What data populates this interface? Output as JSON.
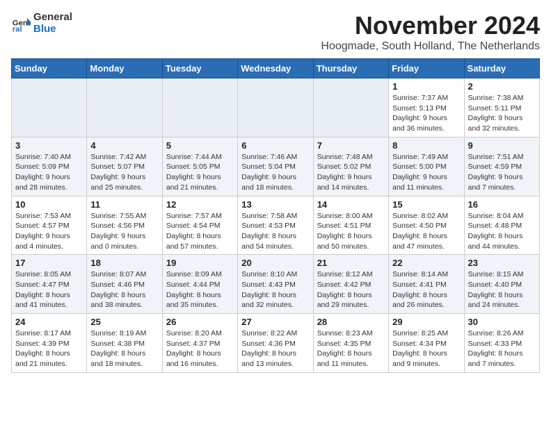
{
  "logo": {
    "text_general": "General",
    "text_blue": "Blue"
  },
  "header": {
    "month": "November 2024",
    "location": "Hoogmade, South Holland, The Netherlands"
  },
  "weekdays": [
    "Sunday",
    "Monday",
    "Tuesday",
    "Wednesday",
    "Thursday",
    "Friday",
    "Saturday"
  ],
  "weeks": [
    [
      {
        "day": "",
        "sunrise": "",
        "sunset": "",
        "daylight": "",
        "empty": true
      },
      {
        "day": "",
        "sunrise": "",
        "sunset": "",
        "daylight": "",
        "empty": true
      },
      {
        "day": "",
        "sunrise": "",
        "sunset": "",
        "daylight": "",
        "empty": true
      },
      {
        "day": "",
        "sunrise": "",
        "sunset": "",
        "daylight": "",
        "empty": true
      },
      {
        "day": "",
        "sunrise": "",
        "sunset": "",
        "daylight": "",
        "empty": true
      },
      {
        "day": "1",
        "sunrise": "Sunrise: 7:37 AM",
        "sunset": "Sunset: 5:13 PM",
        "daylight": "Daylight: 9 hours and 36 minutes.",
        "empty": false
      },
      {
        "day": "2",
        "sunrise": "Sunrise: 7:38 AM",
        "sunset": "Sunset: 5:11 PM",
        "daylight": "Daylight: 9 hours and 32 minutes.",
        "empty": false
      }
    ],
    [
      {
        "day": "3",
        "sunrise": "Sunrise: 7:40 AM",
        "sunset": "Sunset: 5:09 PM",
        "daylight": "Daylight: 9 hours and 28 minutes.",
        "empty": false
      },
      {
        "day": "4",
        "sunrise": "Sunrise: 7:42 AM",
        "sunset": "Sunset: 5:07 PM",
        "daylight": "Daylight: 9 hours and 25 minutes.",
        "empty": false
      },
      {
        "day": "5",
        "sunrise": "Sunrise: 7:44 AM",
        "sunset": "Sunset: 5:05 PM",
        "daylight": "Daylight: 9 hours and 21 minutes.",
        "empty": false
      },
      {
        "day": "6",
        "sunrise": "Sunrise: 7:46 AM",
        "sunset": "Sunset: 5:04 PM",
        "daylight": "Daylight: 9 hours and 18 minutes.",
        "empty": false
      },
      {
        "day": "7",
        "sunrise": "Sunrise: 7:48 AM",
        "sunset": "Sunset: 5:02 PM",
        "daylight": "Daylight: 9 hours and 14 minutes.",
        "empty": false
      },
      {
        "day": "8",
        "sunrise": "Sunrise: 7:49 AM",
        "sunset": "Sunset: 5:00 PM",
        "daylight": "Daylight: 9 hours and 11 minutes.",
        "empty": false
      },
      {
        "day": "9",
        "sunrise": "Sunrise: 7:51 AM",
        "sunset": "Sunset: 4:59 PM",
        "daylight": "Daylight: 9 hours and 7 minutes.",
        "empty": false
      }
    ],
    [
      {
        "day": "10",
        "sunrise": "Sunrise: 7:53 AM",
        "sunset": "Sunset: 4:57 PM",
        "daylight": "Daylight: 9 hours and 4 minutes.",
        "empty": false
      },
      {
        "day": "11",
        "sunrise": "Sunrise: 7:55 AM",
        "sunset": "Sunset: 4:56 PM",
        "daylight": "Daylight: 9 hours and 0 minutes.",
        "empty": false
      },
      {
        "day": "12",
        "sunrise": "Sunrise: 7:57 AM",
        "sunset": "Sunset: 4:54 PM",
        "daylight": "Daylight: 8 hours and 57 minutes.",
        "empty": false
      },
      {
        "day": "13",
        "sunrise": "Sunrise: 7:58 AM",
        "sunset": "Sunset: 4:53 PM",
        "daylight": "Daylight: 8 hours and 54 minutes.",
        "empty": false
      },
      {
        "day": "14",
        "sunrise": "Sunrise: 8:00 AM",
        "sunset": "Sunset: 4:51 PM",
        "daylight": "Daylight: 8 hours and 50 minutes.",
        "empty": false
      },
      {
        "day": "15",
        "sunrise": "Sunrise: 8:02 AM",
        "sunset": "Sunset: 4:50 PM",
        "daylight": "Daylight: 8 hours and 47 minutes.",
        "empty": false
      },
      {
        "day": "16",
        "sunrise": "Sunrise: 8:04 AM",
        "sunset": "Sunset: 4:48 PM",
        "daylight": "Daylight: 8 hours and 44 minutes.",
        "empty": false
      }
    ],
    [
      {
        "day": "17",
        "sunrise": "Sunrise: 8:05 AM",
        "sunset": "Sunset: 4:47 PM",
        "daylight": "Daylight: 8 hours and 41 minutes.",
        "empty": false
      },
      {
        "day": "18",
        "sunrise": "Sunrise: 8:07 AM",
        "sunset": "Sunset: 4:46 PM",
        "daylight": "Daylight: 8 hours and 38 minutes.",
        "empty": false
      },
      {
        "day": "19",
        "sunrise": "Sunrise: 8:09 AM",
        "sunset": "Sunset: 4:44 PM",
        "daylight": "Daylight: 8 hours and 35 minutes.",
        "empty": false
      },
      {
        "day": "20",
        "sunrise": "Sunrise: 8:10 AM",
        "sunset": "Sunset: 4:43 PM",
        "daylight": "Daylight: 8 hours and 32 minutes.",
        "empty": false
      },
      {
        "day": "21",
        "sunrise": "Sunrise: 8:12 AM",
        "sunset": "Sunset: 4:42 PM",
        "daylight": "Daylight: 8 hours and 29 minutes.",
        "empty": false
      },
      {
        "day": "22",
        "sunrise": "Sunrise: 8:14 AM",
        "sunset": "Sunset: 4:41 PM",
        "daylight": "Daylight: 8 hours and 26 minutes.",
        "empty": false
      },
      {
        "day": "23",
        "sunrise": "Sunrise: 8:15 AM",
        "sunset": "Sunset: 4:40 PM",
        "daylight": "Daylight: 8 hours and 24 minutes.",
        "empty": false
      }
    ],
    [
      {
        "day": "24",
        "sunrise": "Sunrise: 8:17 AM",
        "sunset": "Sunset: 4:39 PM",
        "daylight": "Daylight: 8 hours and 21 minutes.",
        "empty": false
      },
      {
        "day": "25",
        "sunrise": "Sunrise: 8:19 AM",
        "sunset": "Sunset: 4:38 PM",
        "daylight": "Daylight: 8 hours and 18 minutes.",
        "empty": false
      },
      {
        "day": "26",
        "sunrise": "Sunrise: 8:20 AM",
        "sunset": "Sunset: 4:37 PM",
        "daylight": "Daylight: 8 hours and 16 minutes.",
        "empty": false
      },
      {
        "day": "27",
        "sunrise": "Sunrise: 8:22 AM",
        "sunset": "Sunset: 4:36 PM",
        "daylight": "Daylight: 8 hours and 13 minutes.",
        "empty": false
      },
      {
        "day": "28",
        "sunrise": "Sunrise: 8:23 AM",
        "sunset": "Sunset: 4:35 PM",
        "daylight": "Daylight: 8 hours and 11 minutes.",
        "empty": false
      },
      {
        "day": "29",
        "sunrise": "Sunrise: 8:25 AM",
        "sunset": "Sunset: 4:34 PM",
        "daylight": "Daylight: 8 hours and 9 minutes.",
        "empty": false
      },
      {
        "day": "30",
        "sunrise": "Sunrise: 8:26 AM",
        "sunset": "Sunset: 4:33 PM",
        "daylight": "Daylight: 8 hours and 7 minutes.",
        "empty": false
      }
    ]
  ]
}
